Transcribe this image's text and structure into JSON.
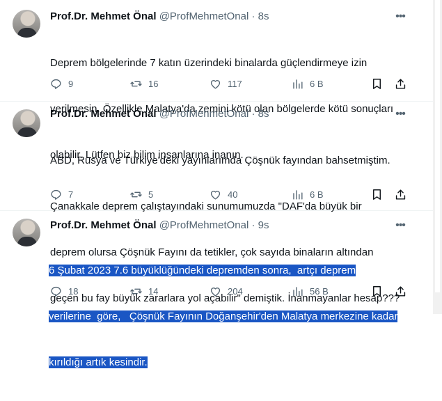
{
  "tweets": [
    {
      "name": "Prof.Dr. Mehmet Önal",
      "handle": "@ProfMehmetOnal",
      "time": "8s",
      "lines": [
        "Deprem bölgelerinde 7 katın üzerindeki binalarda güçlendirmeye izin",
        "verilmesin. Özellikle Malatya'da zemini kötü olan bölgelerde kötü sonuçları",
        "olabilir. Lütfen biz bilim insanlarına inanın."
      ],
      "replies": "9",
      "retweets": "16",
      "likes": "117",
      "views": "6 B"
    },
    {
      "name": "Prof.Dr. Mehmet Önal",
      "handle": "@ProfMehmetOnal",
      "time": "8s",
      "lines": [
        "ABD, Rusya ve Türkiye'deki yayınlarımda Çöşnük fayından bahsetmiştim.",
        "Çanakkale deprem çalıştayındaki sunumumuzda \"DAF'da büyük bir",
        "deprem olursa Çöşnük Fayını da tetikler, çok sayıda binaların altından",
        "geçen bu fay büyük zararlara yol açabilir\" demiştik. İnanmayanlar hesap???"
      ],
      "replies": "7",
      "retweets": "5",
      "likes": "40",
      "views": "6 B"
    },
    {
      "name": "Prof.Dr. Mehmet Önal",
      "handle": "@ProfMehmetOnal",
      "time": "9s",
      "lines": [
        "6 Şubat 2023 7.6 büyüklüğündeki depremden sonra,  artçı deprem",
        "verilerine  göre,   Çöşnük Fayının Doğanşehir'den Malatya merkezine kadar",
        "kırıldığı artık kesindir."
      ],
      "replies": "18",
      "retweets": "14",
      "likes": "204",
      "views": "56 B"
    }
  ],
  "dot": "·",
  "icons": [
    "reply-icon",
    "retweet-icon",
    "like-icon",
    "views-icon",
    "bookmark-icon",
    "share-icon",
    "more-icon"
  ],
  "colors": {
    "selection": "#1a56c4",
    "muted": "#536471",
    "text": "#0f1419"
  }
}
